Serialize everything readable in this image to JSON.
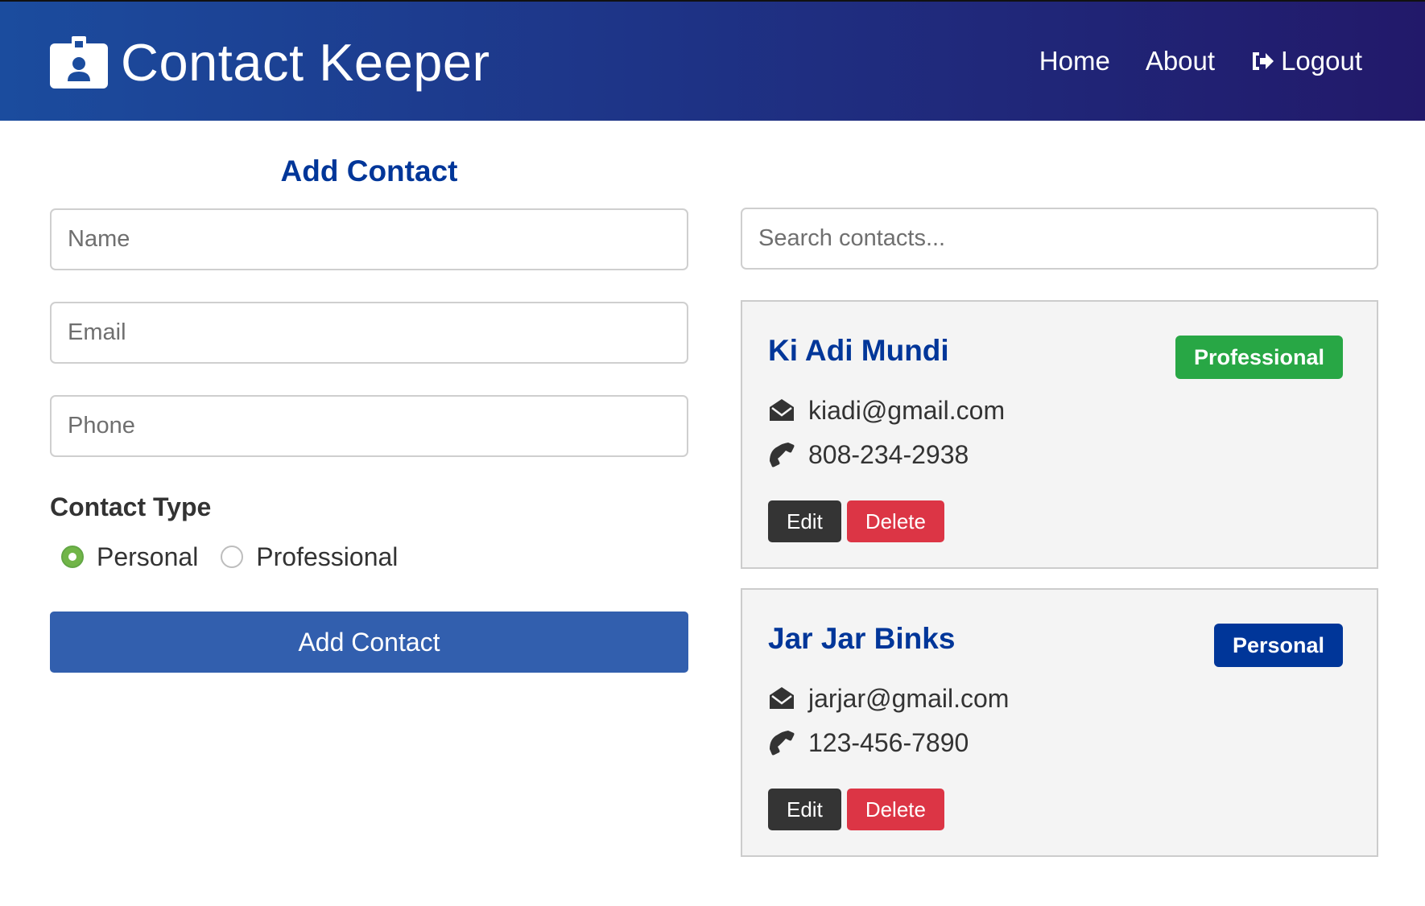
{
  "navbar": {
    "title": "Contact Keeper",
    "links": {
      "home": "Home",
      "about": "About",
      "logout": "Logout"
    }
  },
  "form": {
    "title": "Add Contact",
    "name_placeholder": "Name",
    "email_placeholder": "Email",
    "phone_placeholder": "Phone",
    "contact_type_label": "Contact Type",
    "type_options": {
      "personal": "Personal",
      "professional": "Professional"
    },
    "selected_type": "Personal",
    "submit_label": "Add Contact"
  },
  "search": {
    "placeholder": "Search contacts..."
  },
  "contacts": [
    {
      "name": "Ki Adi Mundi",
      "email": "kiadi@gmail.com",
      "phone": "808-234-2938",
      "type": "Professional",
      "badge_color": "#28a745",
      "edit_label": "Edit",
      "delete_label": "Delete"
    },
    {
      "name": "Jar Jar Binks",
      "email": "jarjar@gmail.com",
      "phone": "123-456-7890",
      "type": "Personal",
      "badge_color": "#003699",
      "edit_label": "Edit",
      "delete_label": "Delete"
    }
  ],
  "colors": {
    "primary": "#003699",
    "submit": "#325fae",
    "success": "#28a745",
    "danger": "#dc3545",
    "dark": "#343434"
  },
  "icons": {
    "brand": "id-badge-icon",
    "logout": "sign-out-icon",
    "email": "envelope-open-icon",
    "phone": "phone-icon"
  }
}
